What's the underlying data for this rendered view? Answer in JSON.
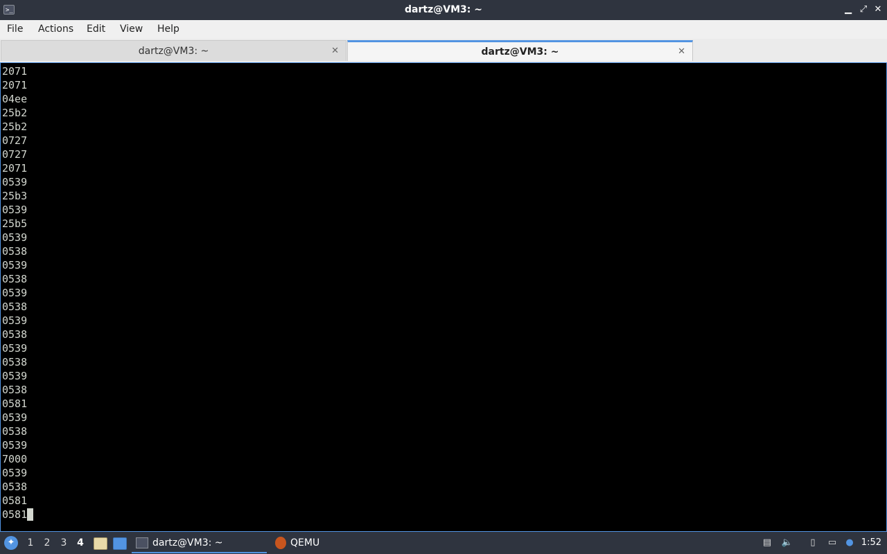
{
  "window": {
    "title": "dartz@VM3: ~",
    "minimize": "▁",
    "maximize": "⤢",
    "close": "✕"
  },
  "menu": {
    "file": "File",
    "actions": "Actions",
    "edit": "Edit",
    "view": "View",
    "help": "Help"
  },
  "tabs": [
    {
      "label": "dartz@VM3: ~",
      "active": false
    },
    {
      "label": "dartz@VM3: ~",
      "active": true
    }
  ],
  "terminal": {
    "lines": [
      "2071",
      "2071",
      "04ee",
      "25b2",
      "25b2",
      "0727",
      "0727",
      "2071",
      "0539",
      "25b3",
      "0539",
      "25b5",
      "0539",
      "0538",
      "0539",
      "0538",
      "0539",
      "0538",
      "0539",
      "0538",
      "0539",
      "0538",
      "0539",
      "0538",
      "0581",
      "0539",
      "0538",
      "0539",
      "7000",
      "0539",
      "0538",
      "0581"
    ],
    "prompt_line": "0581"
  },
  "taskbar": {
    "workspaces": [
      "1",
      "2",
      "3",
      "4"
    ],
    "current_workspace": "4",
    "apps": [
      {
        "label": "dartz@VM3: ~",
        "active": true,
        "icon": "terminal-icon"
      },
      {
        "label": "QEMU",
        "active": false,
        "icon": "qemu-icon"
      }
    ],
    "clock": "1:52"
  },
  "colors": {
    "accent": "#5294e2",
    "panel": "#2f343f",
    "terminal_bg": "#000000",
    "terminal_fg": "#d3d7cf"
  }
}
